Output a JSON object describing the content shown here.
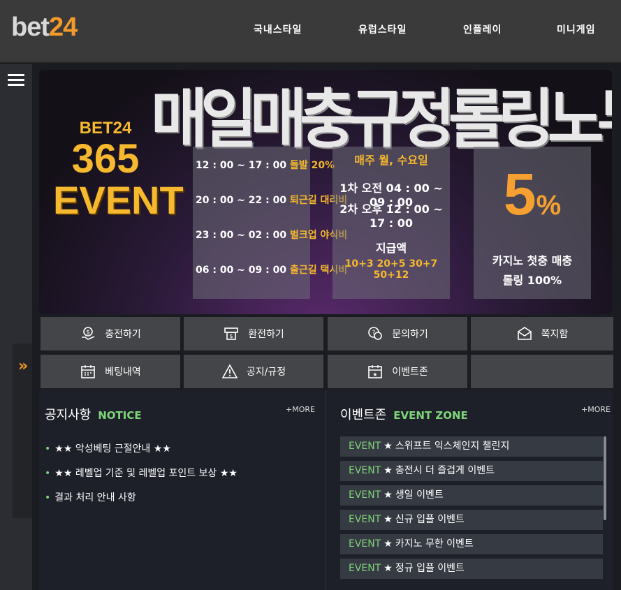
{
  "logo": {
    "part1": "bet",
    "part2": "24"
  },
  "nav": [
    "국내스타일",
    "유럽스타일",
    "인플레이",
    "미니게임"
  ],
  "banner": {
    "headline": "매일매충규정롤링노무",
    "badge": {
      "brand": "BET24",
      "number": "365",
      "word": "EVENT"
    },
    "schedule": [
      {
        "time": "12 : 00 ~ 17 : 00",
        "label": "돌발 20%"
      },
      {
        "time": "20 : 00 ~ 22 : 00",
        "label": "퇴근길 대리비"
      },
      {
        "time": "23 : 00 ~ 02 : 00",
        "label": "벌크업 야식비"
      },
      {
        "time": "06 : 00 ~ 09 : 00",
        "label": "출근길 택시비"
      }
    ],
    "weekly": {
      "head": "매주 월, 수요일",
      "line1": "1차 오전 04 : 00 ~ 09 : 00",
      "line2": "2차 오후 12 : 00 ~ 17 : 00",
      "sub": "지급액",
      "amounts": "10+3 20+5 30+7 50+12"
    },
    "casino": {
      "percent": "5",
      "unit": "%",
      "line1": "카지노 첫충 매충",
      "line2": "롤링 100%"
    }
  },
  "quick": [
    {
      "label": "충전하기",
      "icon": "deposit-icon"
    },
    {
      "label": "환전하기",
      "icon": "withdraw-icon"
    },
    {
      "label": "문의하기",
      "icon": "inquiry-icon"
    },
    {
      "label": "쪽지함",
      "icon": "mail-icon"
    },
    {
      "label": "베팅내역",
      "icon": "calendar-icon"
    },
    {
      "label": "공지/규정",
      "icon": "warning-icon"
    },
    {
      "label": "이벤트존",
      "icon": "event-calendar-icon"
    }
  ],
  "notice": {
    "title": "공지사항",
    "title_en": "NOTICE",
    "more": "+MORE",
    "items": [
      "★★ 악성베팅 근절안내 ★★",
      "★★ 레벨업 기준 및 레벨업 포인트 보상 ★★",
      "결과 처리 안내 사항"
    ]
  },
  "events": {
    "title": "이벤트존",
    "title_en": "EVENT ZONE",
    "more": "+MORE",
    "tag": "EVENT",
    "star": "★",
    "items": [
      "스위프트 익스체인지 챌린지",
      "충전시 더 즐겁게 이벤트",
      "생일 이벤트",
      "신규 입플 이벤트",
      "카지노 무한 이벤트",
      "정규 입플 이벤트"
    ]
  },
  "colors": {
    "accent": "#f39a2b",
    "green": "#7fd47a",
    "header": "#3a3a3a"
  }
}
